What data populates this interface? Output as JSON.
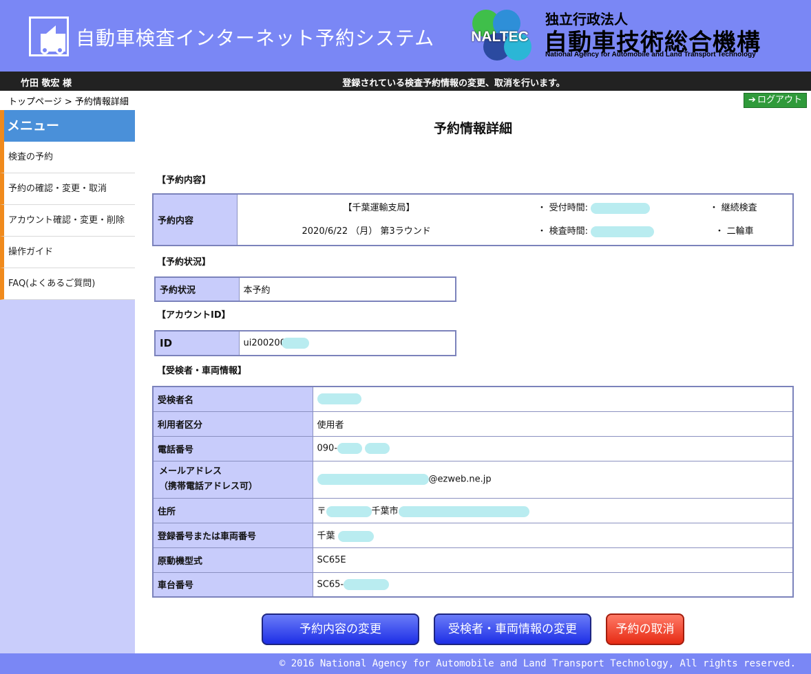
{
  "header": {
    "system_title": "自動車検査インターネット予約システム",
    "logo_text": "NALTEC",
    "org_sub": "独立行政法人",
    "org_main": "自動車技術総合機構",
    "org_en": "National Agency for Automobile and Land Transport Technology"
  },
  "infobar": {
    "user_name": "竹田 敬宏 様",
    "message": "登録されている検査予約情報の変更、取消を行います。"
  },
  "breadcrumb": "トップページ > 予約情報詳細",
  "logout_label": "ログアウト",
  "sidebar": {
    "header": "メニュー",
    "items": [
      {
        "label": "検査の予約"
      },
      {
        "label": "予約の確認・変更・取消"
      },
      {
        "label": "アカウント確認・変更・削除"
      },
      {
        "label": "操作ガイド"
      },
      {
        "label": "FAQ(よくあるご質問)"
      }
    ]
  },
  "page_title": "予約情報詳細",
  "reservation": {
    "section": "【予約内容】",
    "label": "予約内容",
    "office": "【千葉運輸支局】",
    "date": "2020/6/22 （月） 第3ラウンド",
    "reception_label": "・ 受付時間:",
    "inspection_label": "・ 検査時間:",
    "type": "・ 継続検査",
    "vehicle": "・ 二輪車"
  },
  "status": {
    "section": "【予約状況】",
    "label": "予約状況",
    "value": "本予約"
  },
  "account": {
    "section": "【アカウントID】",
    "label": "ID",
    "value": "ui200200"
  },
  "person": {
    "section": "【受検者・車両情報】",
    "rows": [
      {
        "label": "受検者名",
        "value": ""
      },
      {
        "label": "利用者区分",
        "value": "使用者"
      },
      {
        "label": "電話番号",
        "value": "090-"
      },
      {
        "label": "メールアドレス",
        "label2": "（携帯電話アドレス可）",
        "value": "@ezweb.ne.jp"
      },
      {
        "label": "住所",
        "value": "〒",
        "value2": "千葉市"
      },
      {
        "label": "登録番号または車両番号",
        "value": "千葉"
      },
      {
        "label": "原動機型式",
        "value": "SC65E"
      },
      {
        "label": "車台番号",
        "value": "SC65-"
      }
    ]
  },
  "buttons": {
    "change_reservation": "予約内容の変更",
    "change_person": "受検者・車両情報の変更",
    "cancel": "予約の取消"
  },
  "footer": "© 2016 National Agency for Automobile and Land Transport Technology, All rights reserved."
}
